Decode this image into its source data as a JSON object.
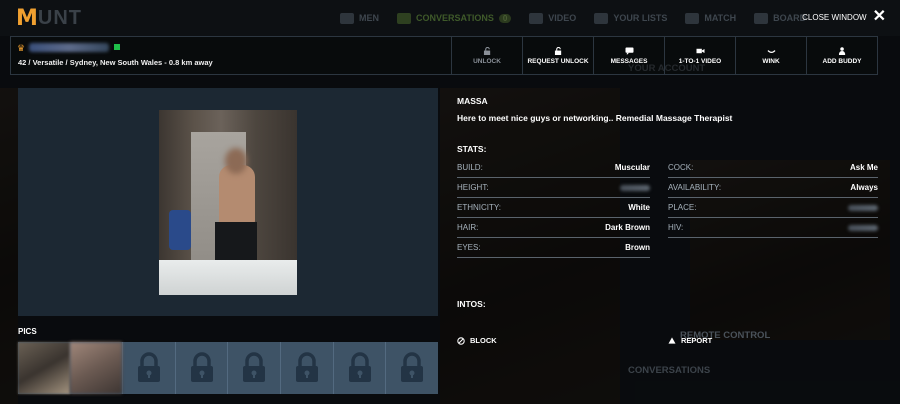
{
  "nav": {
    "logo_letter": "M",
    "logo_rest": "UNT",
    "items": [
      {
        "label": "MEN",
        "icon": "people-icon"
      },
      {
        "label": "CONVERSATIONS",
        "icon": "chat-icon",
        "badge": "0"
      },
      {
        "label": "VIDEO",
        "icon": "video-icon"
      },
      {
        "label": "YOUR LISTS",
        "icon": "list-icon"
      },
      {
        "label": "MATCH",
        "icon": "bolt-icon"
      },
      {
        "label": "BOARD",
        "icon": "board-icon"
      }
    ]
  },
  "close_window": {
    "label": "CLOSE WINDOW"
  },
  "profile": {
    "meta": "42 / Versatile / Sydney, New South Wales  - 0.8 km away",
    "online_color": "#1fbf4a"
  },
  "actions": [
    {
      "label": "UNLOCK",
      "icon": "unlock-icon"
    },
    {
      "label": "REQUEST UNLOCK",
      "icon": "unlock-icon"
    },
    {
      "label": "MESSAGES",
      "icon": "message-icon"
    },
    {
      "label": "1-TO-1 VIDEO",
      "icon": "video-icon"
    },
    {
      "label": "WINK",
      "icon": "wink-icon"
    },
    {
      "label": "ADD BUDDY",
      "icon": "add-user-icon"
    }
  ],
  "pics": {
    "label": "PICS",
    "locked_count": 6
  },
  "info": {
    "name": "MASSA",
    "tagline": "Here to meet nice guys or networking.. Remedial Massage Therapist",
    "stats_title": "STATS:",
    "stats_left": [
      {
        "label": "BUILD:",
        "value": "Muscular"
      },
      {
        "label": "HEIGHT:",
        "value": ""
      },
      {
        "label": "ETHNICITY:",
        "value": "White"
      },
      {
        "label": "HAIR:",
        "value": "Dark Brown"
      },
      {
        "label": "EYES:",
        "value": "Brown"
      }
    ],
    "stats_right": [
      {
        "label": "COCK:",
        "value": "Ask Me"
      },
      {
        "label": "AVAILABILITY:",
        "value": "Always"
      },
      {
        "label": "PLACE:",
        "value": ""
      },
      {
        "label": "HIV:",
        "value": ""
      }
    ],
    "intos_title": "INTOS:",
    "block_label": "BLOCK",
    "report_label": "REPORT"
  },
  "background": {
    "your_account": "YOUR ACCOUNT",
    "remote_control": "REMOTE CONTROL",
    "conversations": "CONVERSATIONS"
  }
}
